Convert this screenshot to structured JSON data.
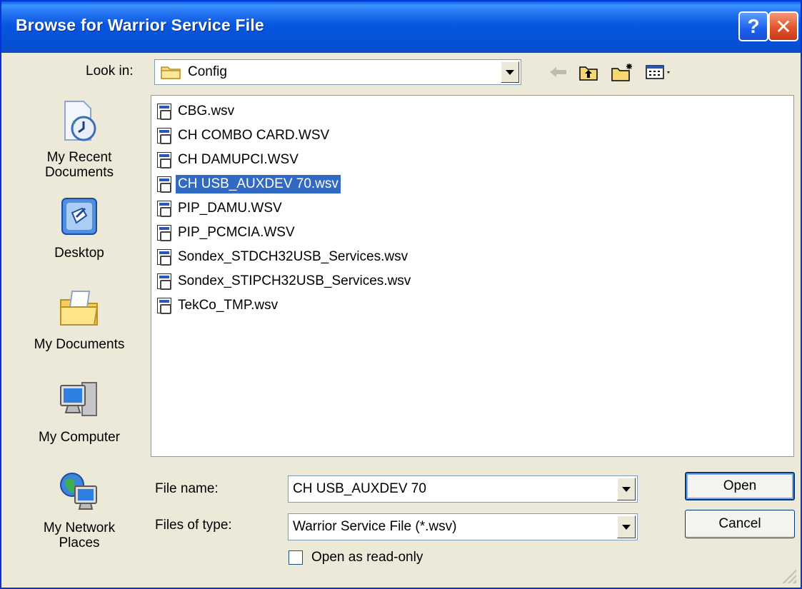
{
  "window": {
    "title": "Browse for Warrior Service File",
    "help_button": "?",
    "close_button": "✕"
  },
  "lookin": {
    "label": "Look in:",
    "value": "Config"
  },
  "places": [
    {
      "label": "My Recent Documents",
      "icon": "my-recent-documents-icon"
    },
    {
      "label": "Desktop",
      "icon": "desktop-icon"
    },
    {
      "label": "My Documents",
      "icon": "my-documents-icon"
    },
    {
      "label": "My Computer",
      "icon": "my-computer-icon"
    },
    {
      "label": "My Network Places",
      "icon": "my-network-places-icon"
    }
  ],
  "places_text": {
    "recent_line1": "My Recent",
    "recent_line2": "Documents",
    "desktop": "Desktop",
    "my_documents": "My Documents",
    "my_computer": "My Computer",
    "network_line1": "My Network",
    "network_line2": "Places"
  },
  "files": [
    "CBG.wsv",
    "CH COMBO CARD.WSV",
    "CH DAMUPCI.WSV",
    "CH USB_AUXDEV 70.wsv",
    "PIP_DAMU.WSV",
    "PIP_PCMCIA.WSV",
    "Sondex_STDCH32USB_Services.wsv",
    "Sondex_STIPCH32USB_Services.wsv",
    "TekCo_TMP.wsv"
  ],
  "selected_file_index": 3,
  "filename": {
    "label": "File name:",
    "value": "CH USB_AUXDEV 70"
  },
  "filetype": {
    "label": "Files of type:",
    "value": "Warrior Service File (*.wsv)"
  },
  "buttons": {
    "open": "Open",
    "cancel": "Cancel"
  },
  "readonly": {
    "label": "Open as read-only",
    "checked": false
  },
  "colors": {
    "titlebar": "#0857e0",
    "selection": "#316ac5",
    "dialog_bg": "#ece9d8"
  }
}
